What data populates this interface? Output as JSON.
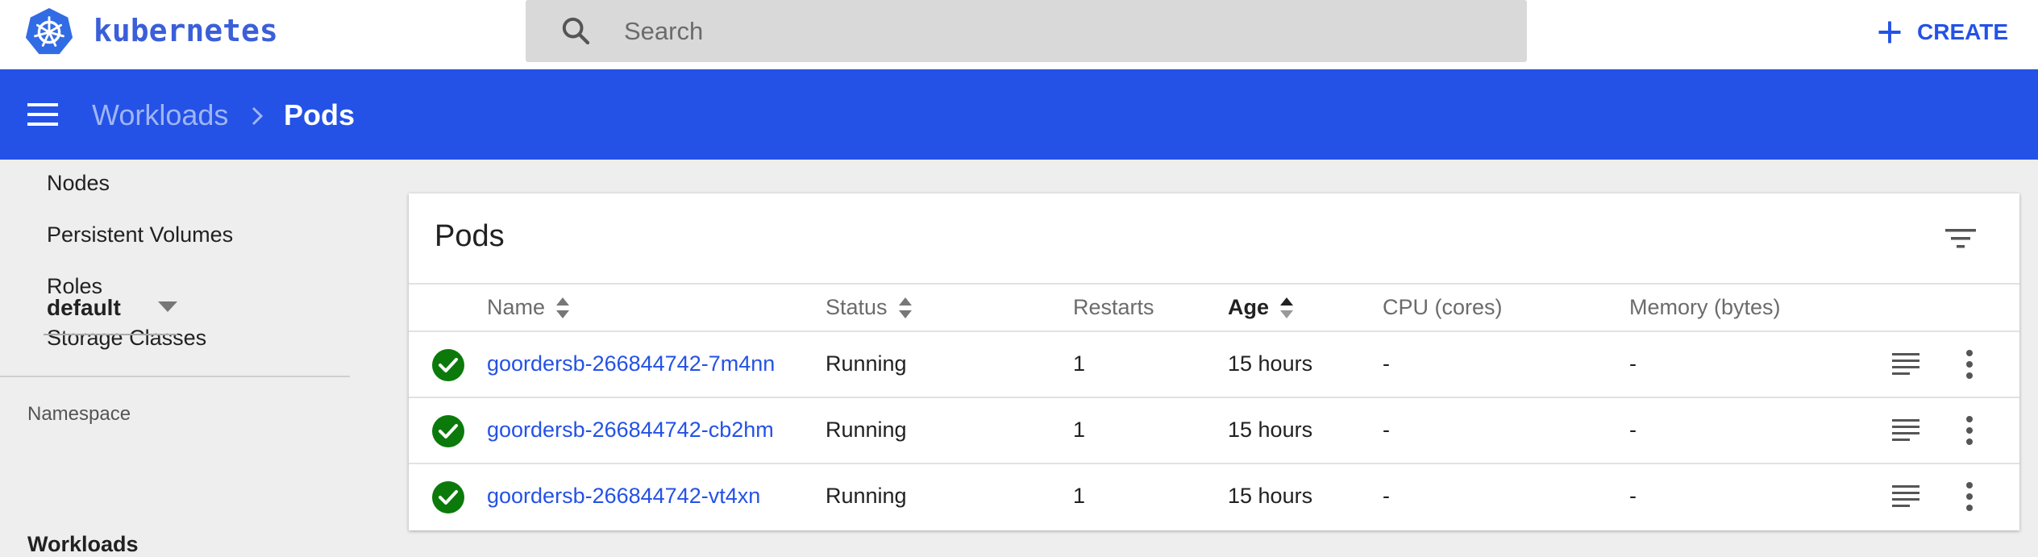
{
  "topbar": {
    "brand": "kubernetes",
    "search_placeholder": "Search",
    "create_label": "CREATE"
  },
  "header": {
    "breadcrumb_parent": "Workloads",
    "breadcrumb_current": "Pods"
  },
  "sidebar": {
    "items": [
      {
        "label": "Nodes"
      },
      {
        "label": "Persistent Volumes"
      },
      {
        "label": "Roles"
      },
      {
        "label": "Storage Classes"
      }
    ],
    "namespace_label": "Namespace",
    "namespace_value": "default",
    "section_label": "Workloads"
  },
  "card": {
    "title": "Pods",
    "columns": [
      "Name",
      "Status",
      "Restarts",
      "Age",
      "CPU (cores)",
      "Memory (bytes)"
    ],
    "rows": [
      {
        "name": "goordersb-266844742-7m4nn",
        "status": "Running",
        "restarts": "1",
        "age": "15 hours",
        "cpu": "-",
        "memory": "-"
      },
      {
        "name": "goordersb-266844742-cb2hm",
        "status": "Running",
        "restarts": "1",
        "age": "15 hours",
        "cpu": "-",
        "memory": "-"
      },
      {
        "name": "goordersb-266844742-vt4xn",
        "status": "Running",
        "restarts": "1",
        "age": "15 hours",
        "cpu": "-",
        "memory": "-"
      }
    ]
  },
  "colors": {
    "brand_blue": "#2452e6",
    "header_blue": "#2452e6",
    "status_green": "#0b7a0b"
  },
  "icons": [
    "kubernetes-logo",
    "search-icon",
    "plus-icon",
    "menu-icon",
    "chevron-right-icon",
    "chevron-down-icon",
    "filter-icon",
    "sort-icon",
    "check-circle-icon",
    "logs-icon",
    "more-vert-icon"
  ]
}
